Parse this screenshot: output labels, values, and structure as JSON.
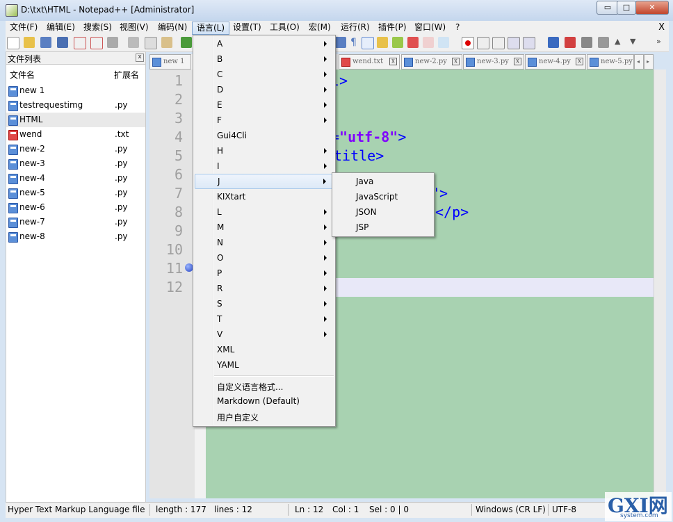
{
  "window": {
    "title": "D:\\txt\\HTML - Notepad++ [Administrator]",
    "minimize": "▭",
    "maximize": "□",
    "close": "✕"
  },
  "menubar": {
    "items": [
      "文件(F)",
      "编辑(E)",
      "搜索(S)",
      "视图(V)",
      "编码(N)",
      "语言(L)",
      "设置(T)",
      "工具(O)",
      "宏(M)",
      "运行(R)",
      "插件(P)",
      "窗口(W)",
      "?"
    ],
    "active": "语言(L)",
    "close_doc": "X"
  },
  "filelist": {
    "title": "文件列表",
    "close": "x",
    "col_name": "文件名",
    "col_ext": "扩展名",
    "files": [
      {
        "name": "new 1",
        "ext": "",
        "icon": "blue"
      },
      {
        "name": "testrequestimg",
        "ext": ".py",
        "icon": "blue"
      },
      {
        "name": "HTML",
        "ext": "",
        "icon": "blue"
      },
      {
        "name": "wend",
        "ext": ".txt",
        "icon": "red"
      },
      {
        "name": "new-2",
        "ext": ".py",
        "icon": "blue"
      },
      {
        "name": "new-3",
        "ext": ".py",
        "icon": "blue"
      },
      {
        "name": "new-4",
        "ext": ".py",
        "icon": "blue"
      },
      {
        "name": "new-5",
        "ext": ".py",
        "icon": "blue"
      },
      {
        "name": "new-6",
        "ext": ".py",
        "icon": "blue"
      },
      {
        "name": "new-7",
        "ext": ".py",
        "icon": "blue"
      },
      {
        "name": "new-8",
        "ext": ".py",
        "icon": "blue"
      }
    ]
  },
  "tabs": [
    "new 1",
    "wend.txt",
    "new-2.py",
    "new-3.py",
    "new-4.py",
    "new-5.py"
  ],
  "tab_close": "x",
  "editor": {
    "line_numbers": [
      "1",
      "2",
      "3",
      "4",
      "5",
      "6",
      "7",
      "8",
      "9",
      "10",
      "11",
      "12"
    ],
    "visible_code": {
      "line1": "l>",
      "line4_attr": "=",
      "line4_value": "\"utf-8\"",
      "line4_end": ">",
      "line5": "title>",
      "line7": "\">",
      "line8": "</p>"
    }
  },
  "language_menu": {
    "items": [
      {
        "label": "A",
        "submenu": true
      },
      {
        "label": "B",
        "submenu": true
      },
      {
        "label": "C",
        "submenu": true
      },
      {
        "label": "D",
        "submenu": true
      },
      {
        "label": "E",
        "submenu": true
      },
      {
        "label": "F",
        "submenu": true
      },
      {
        "label": "Gui4Cli",
        "submenu": false
      },
      {
        "label": "H",
        "submenu": true
      },
      {
        "label": "I",
        "submenu": true
      },
      {
        "label": "J",
        "submenu": true
      },
      {
        "label": "KIXtart",
        "submenu": false
      },
      {
        "label": "L",
        "submenu": true
      },
      {
        "label": "M",
        "submenu": true
      },
      {
        "label": "N",
        "submenu": true
      },
      {
        "label": "O",
        "submenu": true
      },
      {
        "label": "P",
        "submenu": true
      },
      {
        "label": "R",
        "submenu": true
      },
      {
        "label": "S",
        "submenu": true
      },
      {
        "label": "T",
        "submenu": true
      },
      {
        "label": "V",
        "submenu": true
      },
      {
        "label": "XML",
        "submenu": false
      },
      {
        "label": "YAML",
        "submenu": false
      }
    ],
    "highlighted": "J",
    "extra_items": [
      "自定义语言格式...",
      "Markdown (Default)",
      "用户自定义"
    ]
  },
  "j_submenu": {
    "items": [
      "Java",
      "JavaScript",
      "JSON",
      "JSP"
    ]
  },
  "statusbar": {
    "file_type": "Hyper Text Markup Language file",
    "length": "length : 177",
    "lines": "lines : 12",
    "ln": "Ln : 12",
    "col": "Col : 1",
    "sel": "Sel : 0 | 0",
    "eol": "Windows (CR LF)",
    "encoding": "UTF-8"
  },
  "watermark": {
    "logo": "GXI网",
    "url": "system.com"
  }
}
